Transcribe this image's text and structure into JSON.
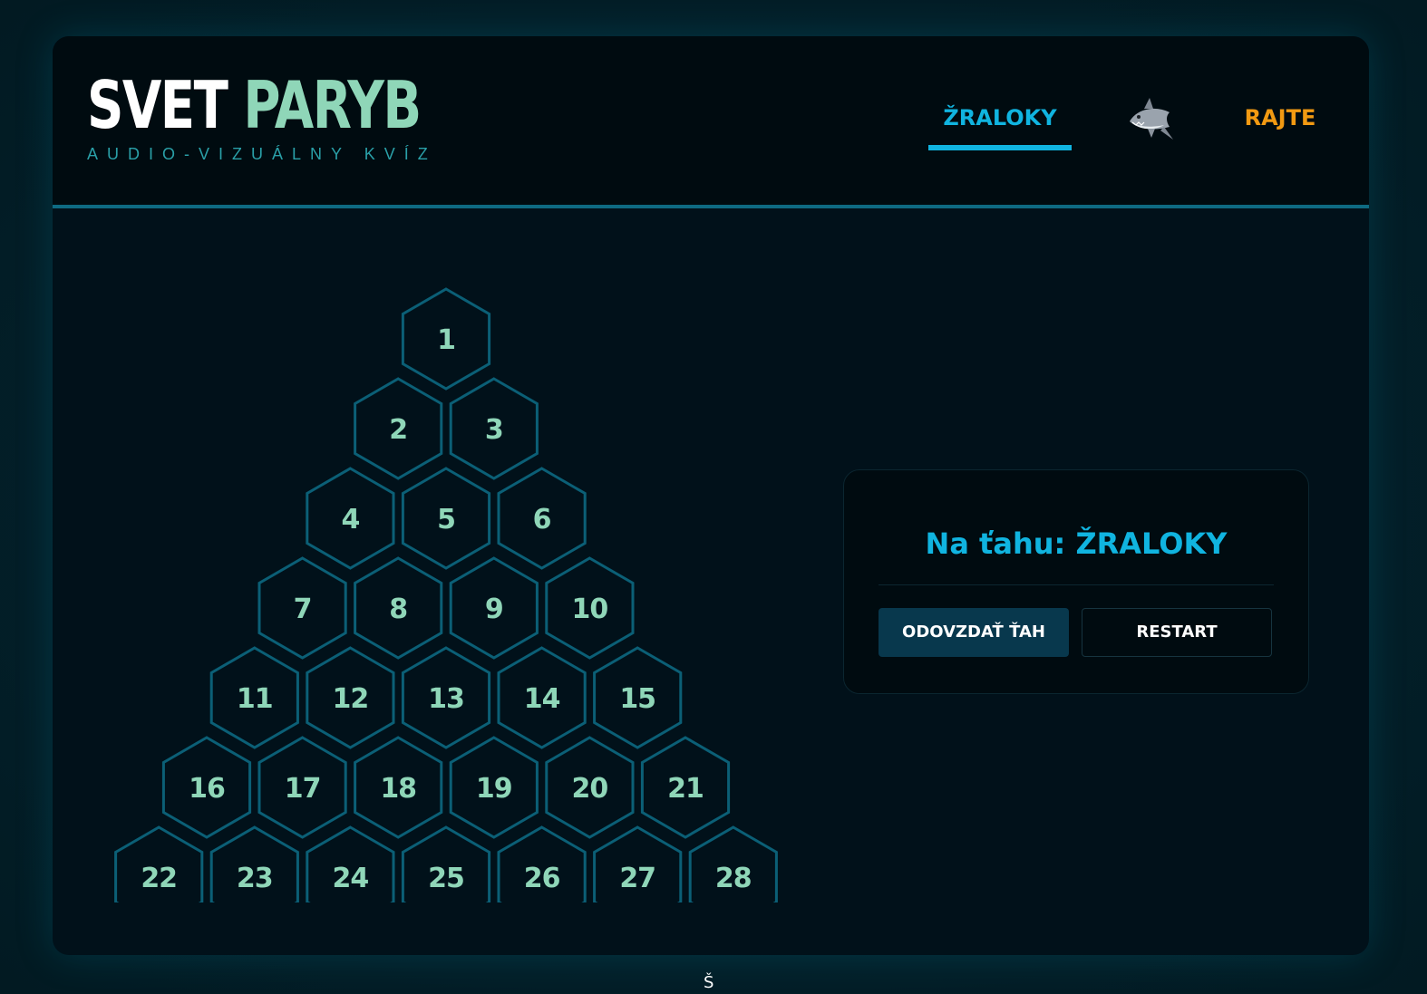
{
  "brand": {
    "title_part1": "SVET",
    "title_part2": "PARYB",
    "subtitle": "AUDIO-VIZUÁLNY KVÍZ"
  },
  "nav": {
    "team_a": "ŽRALOKY",
    "team_b": "RAJTE",
    "active_team": "team_a",
    "turn_indicator_icon": "shark-icon"
  },
  "board": {
    "rows": 7,
    "cells": [
      "1",
      "2",
      "3",
      "4",
      "5",
      "6",
      "7",
      "8",
      "9",
      "10",
      "11",
      "12",
      "13",
      "14",
      "15",
      "16",
      "17",
      "18",
      "19",
      "20",
      "21",
      "22",
      "23",
      "24",
      "25",
      "26",
      "27",
      "28"
    ]
  },
  "panel": {
    "status_prefix": "Na ťahu:",
    "status_team": "ŽRALOKY",
    "forfeit_label": "ODOVZDAŤ ŤAH",
    "restart_label": "RESTART"
  },
  "footer": {
    "glyph": "Š"
  },
  "colors": {
    "background": "#01111a",
    "header": "#000b10",
    "accent_blue": "#10b4e0",
    "accent_orange": "#f29a12",
    "hex_stroke": "#0b5f76",
    "hex_text": "#8fd6b8"
  }
}
